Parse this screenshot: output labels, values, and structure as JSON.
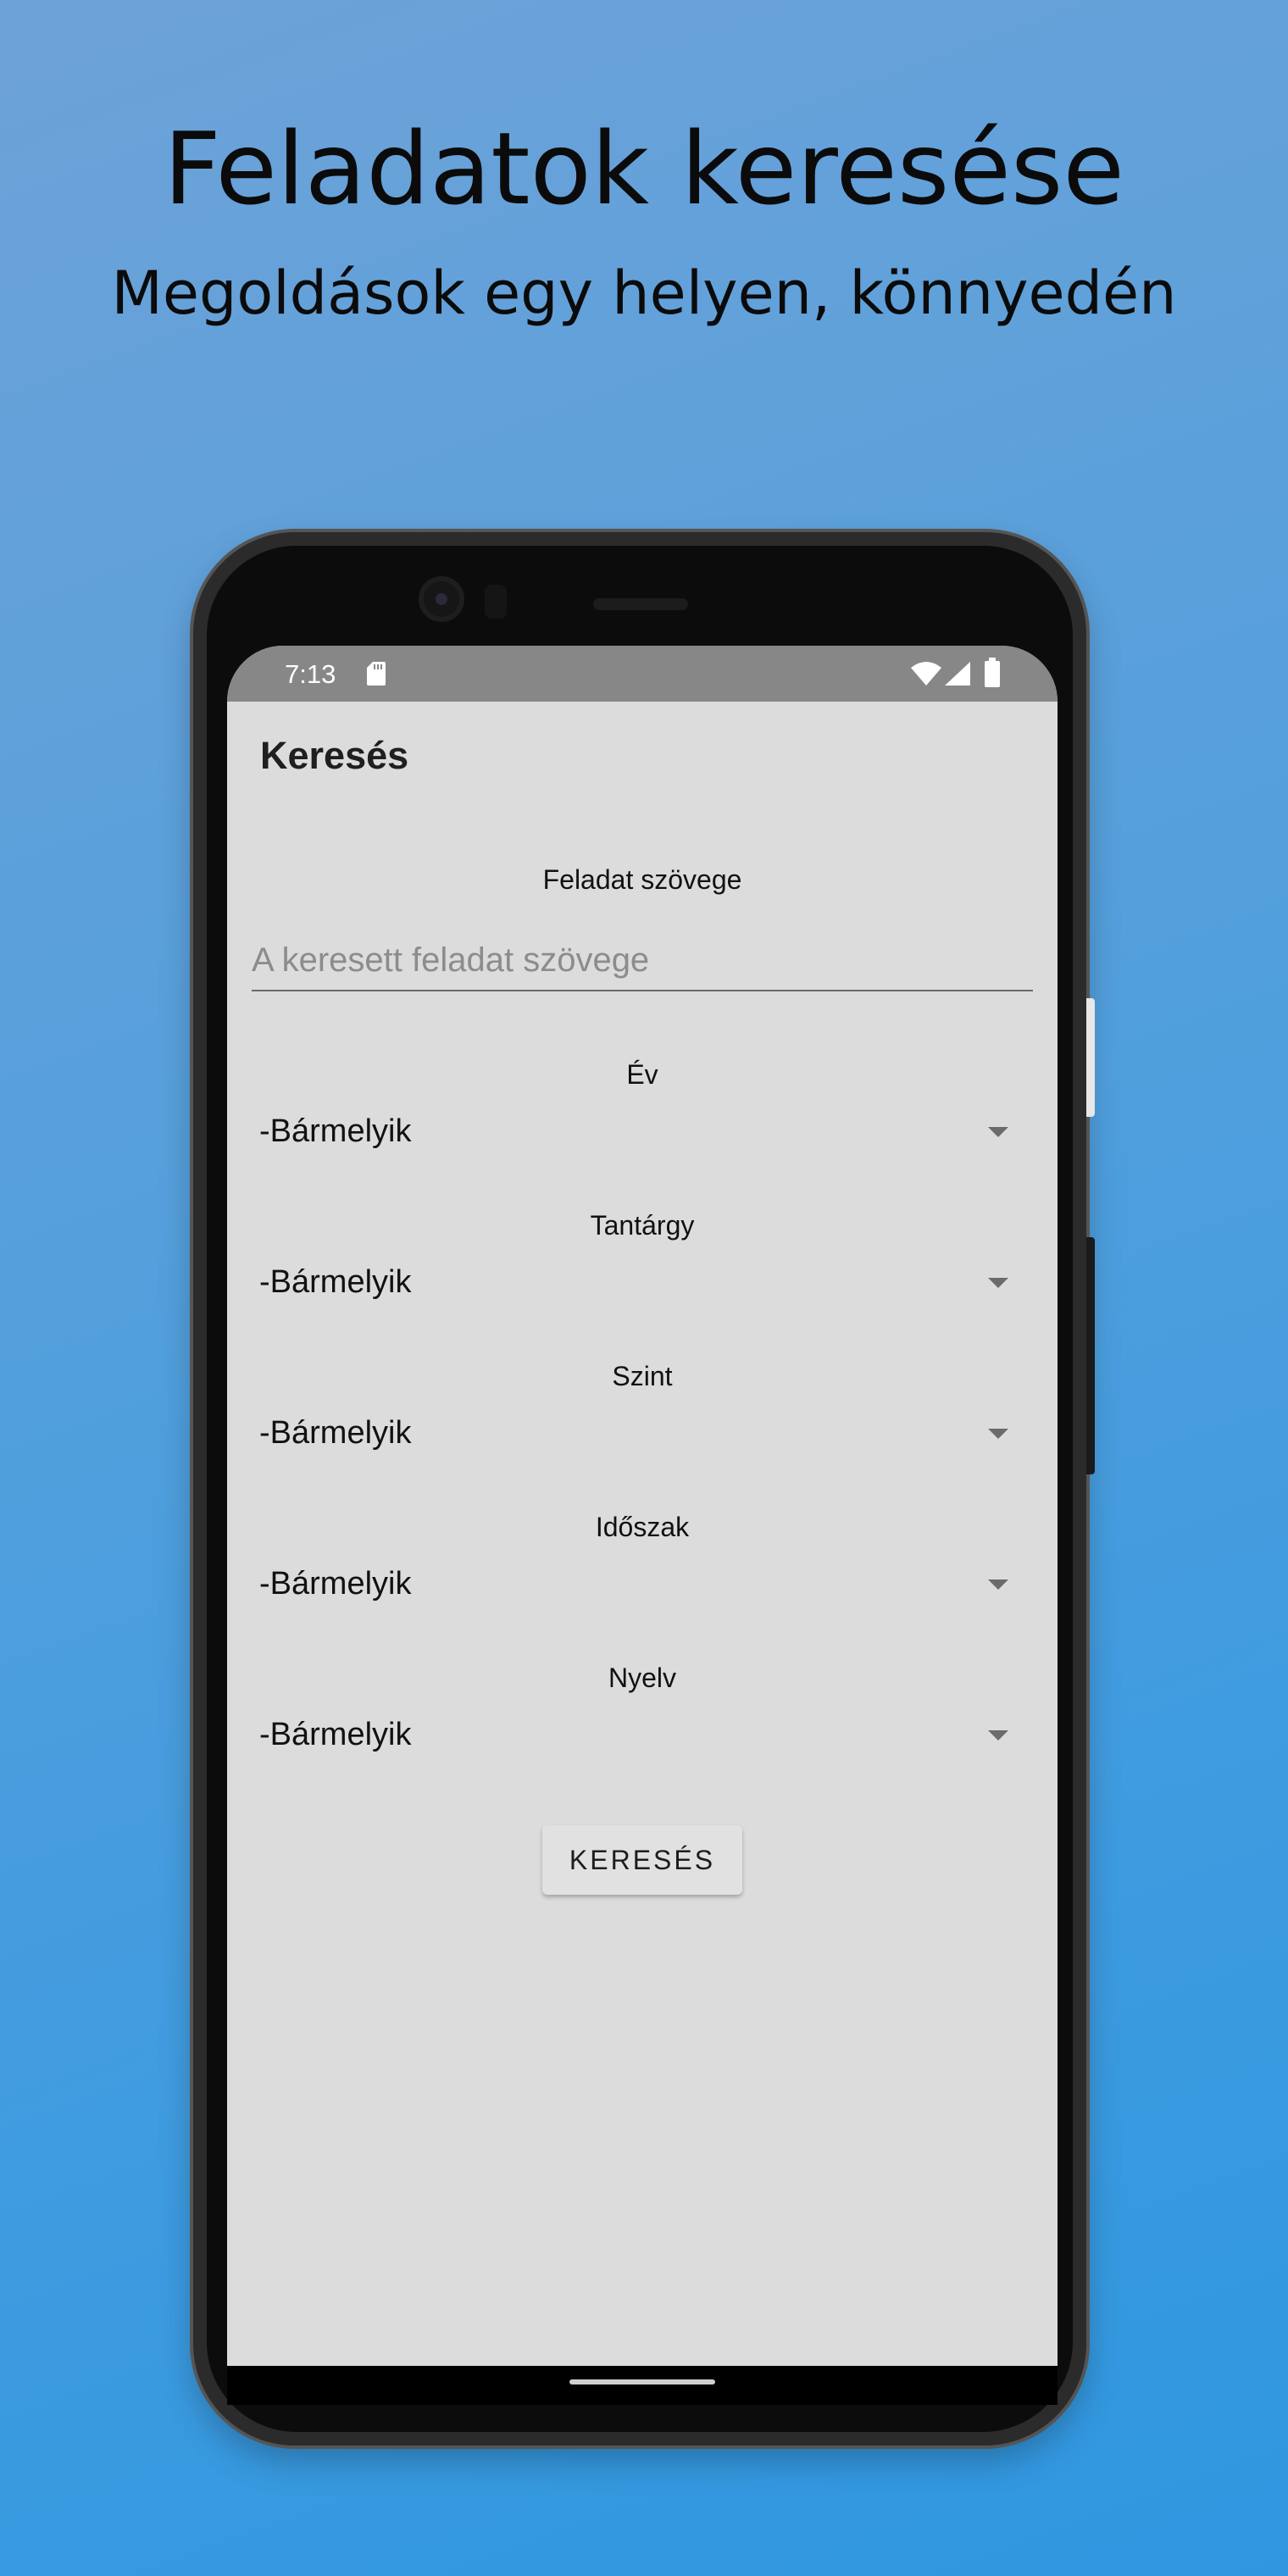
{
  "promo": {
    "headline": "Feladatok keresése",
    "subheadline": "Megoldások egy helyen, könnyedén"
  },
  "status_bar": {
    "time": "7:13",
    "icons": [
      "sd-card-icon",
      "wifi-icon",
      "cell-signal-icon",
      "battery-icon"
    ]
  },
  "app": {
    "title": "Keresés"
  },
  "form": {
    "text_label": "Feladat szövege",
    "text_placeholder": "A keresett feladat szövege",
    "text_value": "",
    "fields": [
      {
        "label": "Év",
        "selected": "-Bármelyik"
      },
      {
        "label": "Tantárgy",
        "selected": "-Bármelyik"
      },
      {
        "label": "Szint",
        "selected": "-Bármelyik"
      },
      {
        "label": "Időszak",
        "selected": "-Bármelyik"
      },
      {
        "label": "Nyelv",
        "selected": "-Bármelyik"
      }
    ],
    "submit_label": "KERESÉS"
  },
  "colors": {
    "background_top": "#6da2d8",
    "background_bottom": "#2f97e0",
    "screen_bg": "#dcdcdc",
    "status_bar_bg": "#878787"
  }
}
